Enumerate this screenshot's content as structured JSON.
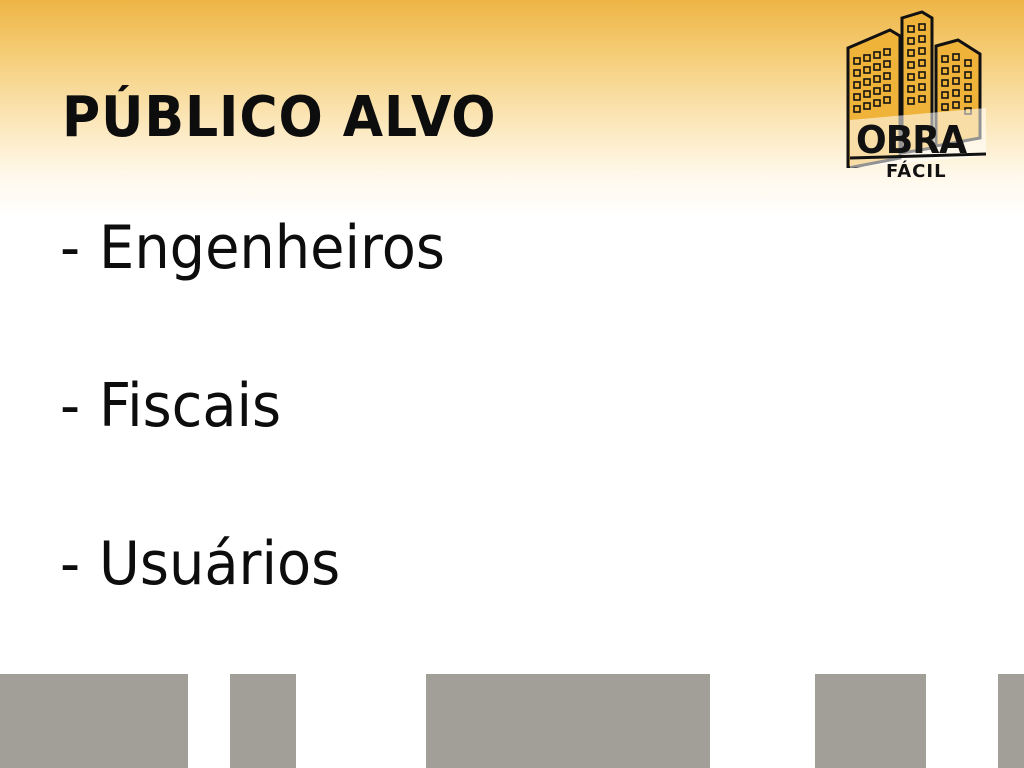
{
  "slide": {
    "title": "PÚBLICO ALVO",
    "bullets": [
      {
        "dash": "-",
        "text": "Engenheiros"
      },
      {
        "dash": "-",
        "text": "Fiscais"
      },
      {
        "dash": "-",
        "text": "Usuários"
      }
    ]
  },
  "logo": {
    "name": "OBRA",
    "subtitle": "FÁCIL",
    "icon": "buildings-icon"
  },
  "colors": {
    "accent": "#eeb545",
    "building_fill": "#f0b33a",
    "text": "#0d0d0d",
    "footer_blocks": "#a29f98"
  }
}
